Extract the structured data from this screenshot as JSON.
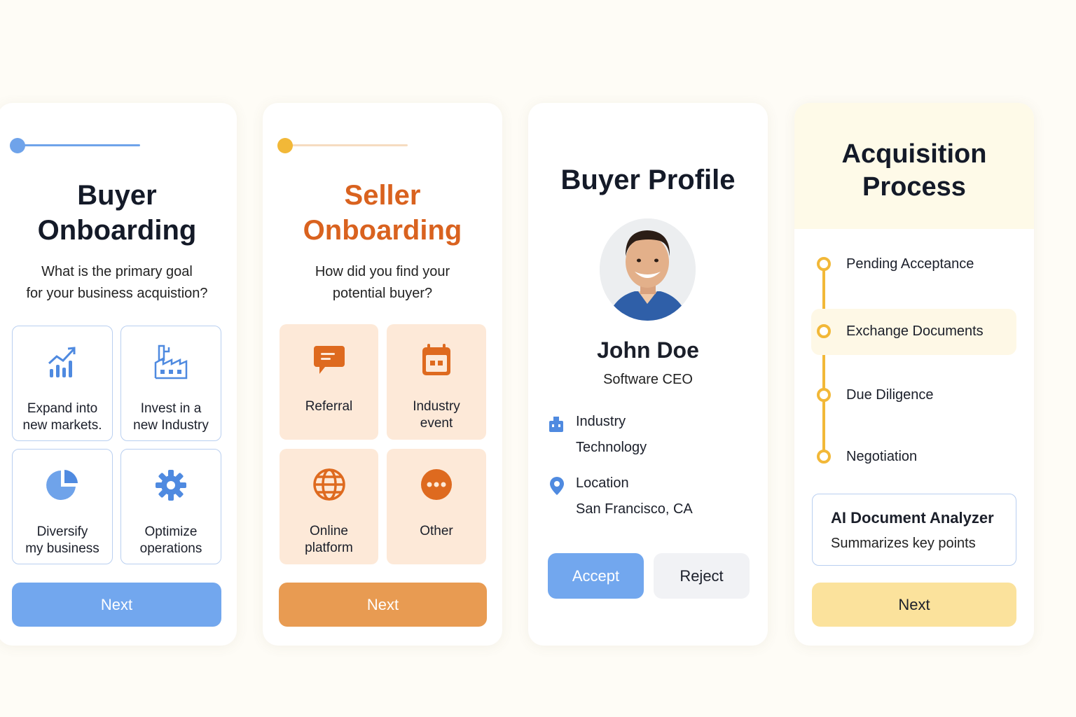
{
  "buyer_onboarding": {
    "title_line1": "Buyer",
    "title_line2": "Onboarding",
    "question_line1": "What is the primary goal",
    "question_line2": "for your business acquistion?",
    "progress": 0.0,
    "options": [
      {
        "line1": "Expand into",
        "line2": "new markets.",
        "icon": "growth-chart-icon"
      },
      {
        "line1": "Invest in a",
        "line2": "new Industry",
        "icon": "factory-icon"
      },
      {
        "line1": "Diversify",
        "line2": "my business",
        "icon": "pie-chart-icon"
      },
      {
        "line1": "Optimize",
        "line2": "operations",
        "icon": "gear-icon"
      }
    ],
    "next_label": "Next",
    "accent": "#6fa3ea"
  },
  "seller_onboarding": {
    "title_line1": "Seller",
    "title_line2": "Onboarding",
    "question_line1": "How did you find your",
    "question_line2": "potential buyer?",
    "progress": 0.0,
    "options": [
      {
        "line1": "Referral",
        "line2": "",
        "icon": "chat-bubble-icon"
      },
      {
        "line1": "Industry",
        "line2": "event",
        "icon": "calendar-icon"
      },
      {
        "line1": "Online",
        "line2": "platform",
        "icon": "globe-icon"
      },
      {
        "line1": "Other",
        "line2": "",
        "icon": "more-dots-icon"
      }
    ],
    "next_label": "Next",
    "accent": "#e89b52"
  },
  "buyer_profile": {
    "title": "Buyer Profile",
    "name": "John Doe",
    "role": "Software CEO",
    "industry_label": "Industry",
    "industry_value": "Technology",
    "location_label": "Location",
    "location_value": "San Francisco, CA",
    "accept_label": "Accept",
    "reject_label": "Reject"
  },
  "acquisition_process": {
    "title_line1": "Acquisition",
    "title_line2": "Process",
    "steps": [
      {
        "label": "Pending Acceptance",
        "active": false
      },
      {
        "label": "Exchange Documents",
        "active": true
      },
      {
        "label": "Due Diligence",
        "active": false
      },
      {
        "label": "Negotiation",
        "active": false
      }
    ],
    "analyzer_title": "AI Document Analyzer",
    "analyzer_subtitle": "Summarizes key points",
    "next_label": "Next",
    "accent": "#f2b838"
  }
}
